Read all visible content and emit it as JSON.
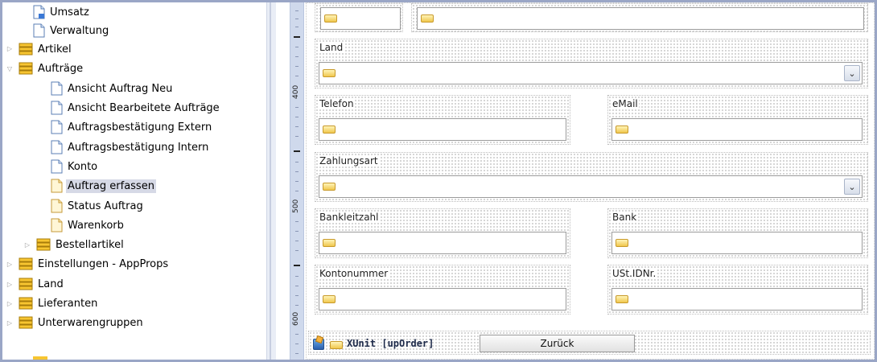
{
  "tree": {
    "items": [
      {
        "label": "Umsatz",
        "kind": "page-arrow",
        "level": 1
      },
      {
        "label": "Verwaltung",
        "kind": "page",
        "level": 1
      },
      {
        "label": "Artikel",
        "kind": "db",
        "level": 0,
        "expander": "collapsed"
      },
      {
        "label": "Aufträge",
        "kind": "db",
        "level": 0,
        "expander": "expanded"
      },
      {
        "label": "Ansicht Auftrag Neu",
        "kind": "page",
        "level": 2
      },
      {
        "label": "Ansicht Bearbeitete Aufträge",
        "kind": "page",
        "level": 2
      },
      {
        "label": "Auftragsbestätigung Extern",
        "kind": "page",
        "level": 2
      },
      {
        "label": "Auftragsbestätigung Intern",
        "kind": "page",
        "level": 2
      },
      {
        "label": "Konto",
        "kind": "page",
        "level": 2
      },
      {
        "label": "Auftrag erfassen",
        "kind": "page-yellow",
        "level": 2,
        "selected": true
      },
      {
        "label": "Status Auftrag",
        "kind": "page-yellow",
        "level": 2
      },
      {
        "label": "Warenkorb",
        "kind": "page-yellow",
        "level": 2
      },
      {
        "label": "Bestellartikel",
        "kind": "db",
        "level": 1,
        "expander": "collapsed"
      },
      {
        "label": "Einstellungen - AppProps",
        "kind": "db",
        "level": 0,
        "expander": "collapsed"
      },
      {
        "label": "Land",
        "kind": "db",
        "level": 0,
        "expander": "collapsed"
      },
      {
        "label": "Lieferanten",
        "kind": "db",
        "level": 0,
        "expander": "collapsed"
      },
      {
        "label": "Unterwarengruppen",
        "kind": "db",
        "level": 0,
        "expander": "collapsed"
      }
    ]
  },
  "ruler": {
    "labels": [
      "400",
      "500",
      "600"
    ]
  },
  "form": {
    "land_label": "Land",
    "telefon_label": "Telefon",
    "email_label": "eMail",
    "zahlungsart_label": "Zahlungsart",
    "bankleitzahl_label": "Bankleitzahl",
    "bank_label": "Bank",
    "kontonummer_label": "Kontonummer",
    "ustid_label": "USt.IDNr.",
    "dropdown_glyph": "⌄"
  },
  "footer": {
    "unit_label": "XUnit [upOrder]",
    "back_label": "Zurück"
  },
  "colors": {
    "selection": "#d6d9e6",
    "ruler": "#cfd9ec",
    "frame": "#9aa6c6"
  }
}
